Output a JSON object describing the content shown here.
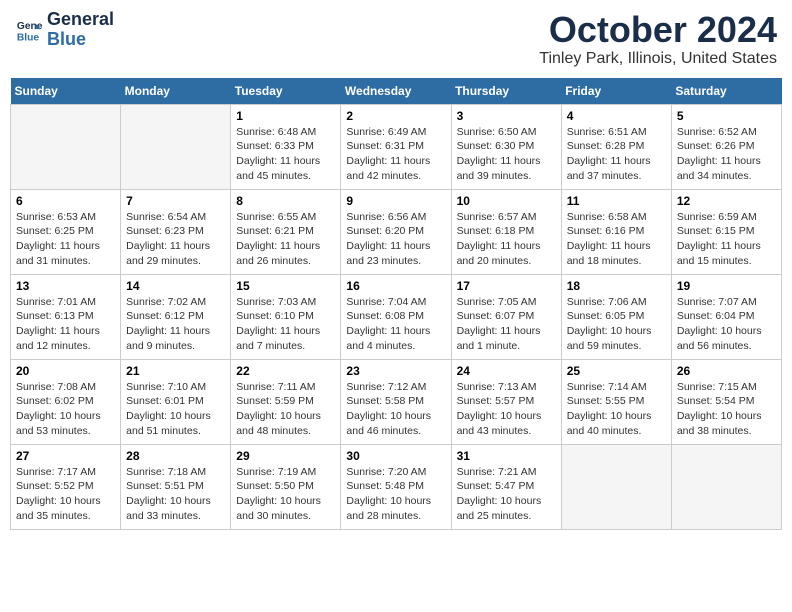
{
  "header": {
    "logo_line1": "General",
    "logo_line2": "Blue",
    "month": "October 2024",
    "location": "Tinley Park, Illinois, United States"
  },
  "weekdays": [
    "Sunday",
    "Monday",
    "Tuesday",
    "Wednesday",
    "Thursday",
    "Friday",
    "Saturday"
  ],
  "weeks": [
    [
      {
        "day": "",
        "sunrise": "",
        "sunset": "",
        "daylight": "",
        "empty": true
      },
      {
        "day": "",
        "sunrise": "",
        "sunset": "",
        "daylight": "",
        "empty": true
      },
      {
        "day": "1",
        "sunrise": "Sunrise: 6:48 AM",
        "sunset": "Sunset: 6:33 PM",
        "daylight": "Daylight: 11 hours and 45 minutes.",
        "empty": false
      },
      {
        "day": "2",
        "sunrise": "Sunrise: 6:49 AM",
        "sunset": "Sunset: 6:31 PM",
        "daylight": "Daylight: 11 hours and 42 minutes.",
        "empty": false
      },
      {
        "day": "3",
        "sunrise": "Sunrise: 6:50 AM",
        "sunset": "Sunset: 6:30 PM",
        "daylight": "Daylight: 11 hours and 39 minutes.",
        "empty": false
      },
      {
        "day": "4",
        "sunrise": "Sunrise: 6:51 AM",
        "sunset": "Sunset: 6:28 PM",
        "daylight": "Daylight: 11 hours and 37 minutes.",
        "empty": false
      },
      {
        "day": "5",
        "sunrise": "Sunrise: 6:52 AM",
        "sunset": "Sunset: 6:26 PM",
        "daylight": "Daylight: 11 hours and 34 minutes.",
        "empty": false
      }
    ],
    [
      {
        "day": "6",
        "sunrise": "Sunrise: 6:53 AM",
        "sunset": "Sunset: 6:25 PM",
        "daylight": "Daylight: 11 hours and 31 minutes.",
        "empty": false
      },
      {
        "day": "7",
        "sunrise": "Sunrise: 6:54 AM",
        "sunset": "Sunset: 6:23 PM",
        "daylight": "Daylight: 11 hours and 29 minutes.",
        "empty": false
      },
      {
        "day": "8",
        "sunrise": "Sunrise: 6:55 AM",
        "sunset": "Sunset: 6:21 PM",
        "daylight": "Daylight: 11 hours and 26 minutes.",
        "empty": false
      },
      {
        "day": "9",
        "sunrise": "Sunrise: 6:56 AM",
        "sunset": "Sunset: 6:20 PM",
        "daylight": "Daylight: 11 hours and 23 minutes.",
        "empty": false
      },
      {
        "day": "10",
        "sunrise": "Sunrise: 6:57 AM",
        "sunset": "Sunset: 6:18 PM",
        "daylight": "Daylight: 11 hours and 20 minutes.",
        "empty": false
      },
      {
        "day": "11",
        "sunrise": "Sunrise: 6:58 AM",
        "sunset": "Sunset: 6:16 PM",
        "daylight": "Daylight: 11 hours and 18 minutes.",
        "empty": false
      },
      {
        "day": "12",
        "sunrise": "Sunrise: 6:59 AM",
        "sunset": "Sunset: 6:15 PM",
        "daylight": "Daylight: 11 hours and 15 minutes.",
        "empty": false
      }
    ],
    [
      {
        "day": "13",
        "sunrise": "Sunrise: 7:01 AM",
        "sunset": "Sunset: 6:13 PM",
        "daylight": "Daylight: 11 hours and 12 minutes.",
        "empty": false
      },
      {
        "day": "14",
        "sunrise": "Sunrise: 7:02 AM",
        "sunset": "Sunset: 6:12 PM",
        "daylight": "Daylight: 11 hours and 9 minutes.",
        "empty": false
      },
      {
        "day": "15",
        "sunrise": "Sunrise: 7:03 AM",
        "sunset": "Sunset: 6:10 PM",
        "daylight": "Daylight: 11 hours and 7 minutes.",
        "empty": false
      },
      {
        "day": "16",
        "sunrise": "Sunrise: 7:04 AM",
        "sunset": "Sunset: 6:08 PM",
        "daylight": "Daylight: 11 hours and 4 minutes.",
        "empty": false
      },
      {
        "day": "17",
        "sunrise": "Sunrise: 7:05 AM",
        "sunset": "Sunset: 6:07 PM",
        "daylight": "Daylight: 11 hours and 1 minute.",
        "empty": false
      },
      {
        "day": "18",
        "sunrise": "Sunrise: 7:06 AM",
        "sunset": "Sunset: 6:05 PM",
        "daylight": "Daylight: 10 hours and 59 minutes.",
        "empty": false
      },
      {
        "day": "19",
        "sunrise": "Sunrise: 7:07 AM",
        "sunset": "Sunset: 6:04 PM",
        "daylight": "Daylight: 10 hours and 56 minutes.",
        "empty": false
      }
    ],
    [
      {
        "day": "20",
        "sunrise": "Sunrise: 7:08 AM",
        "sunset": "Sunset: 6:02 PM",
        "daylight": "Daylight: 10 hours and 53 minutes.",
        "empty": false
      },
      {
        "day": "21",
        "sunrise": "Sunrise: 7:10 AM",
        "sunset": "Sunset: 6:01 PM",
        "daylight": "Daylight: 10 hours and 51 minutes.",
        "empty": false
      },
      {
        "day": "22",
        "sunrise": "Sunrise: 7:11 AM",
        "sunset": "Sunset: 5:59 PM",
        "daylight": "Daylight: 10 hours and 48 minutes.",
        "empty": false
      },
      {
        "day": "23",
        "sunrise": "Sunrise: 7:12 AM",
        "sunset": "Sunset: 5:58 PM",
        "daylight": "Daylight: 10 hours and 46 minutes.",
        "empty": false
      },
      {
        "day": "24",
        "sunrise": "Sunrise: 7:13 AM",
        "sunset": "Sunset: 5:57 PM",
        "daylight": "Daylight: 10 hours and 43 minutes.",
        "empty": false
      },
      {
        "day": "25",
        "sunrise": "Sunrise: 7:14 AM",
        "sunset": "Sunset: 5:55 PM",
        "daylight": "Daylight: 10 hours and 40 minutes.",
        "empty": false
      },
      {
        "day": "26",
        "sunrise": "Sunrise: 7:15 AM",
        "sunset": "Sunset: 5:54 PM",
        "daylight": "Daylight: 10 hours and 38 minutes.",
        "empty": false
      }
    ],
    [
      {
        "day": "27",
        "sunrise": "Sunrise: 7:17 AM",
        "sunset": "Sunset: 5:52 PM",
        "daylight": "Daylight: 10 hours and 35 minutes.",
        "empty": false
      },
      {
        "day": "28",
        "sunrise": "Sunrise: 7:18 AM",
        "sunset": "Sunset: 5:51 PM",
        "daylight": "Daylight: 10 hours and 33 minutes.",
        "empty": false
      },
      {
        "day": "29",
        "sunrise": "Sunrise: 7:19 AM",
        "sunset": "Sunset: 5:50 PM",
        "daylight": "Daylight: 10 hours and 30 minutes.",
        "empty": false
      },
      {
        "day": "30",
        "sunrise": "Sunrise: 7:20 AM",
        "sunset": "Sunset: 5:48 PM",
        "daylight": "Daylight: 10 hours and 28 minutes.",
        "empty": false
      },
      {
        "day": "31",
        "sunrise": "Sunrise: 7:21 AM",
        "sunset": "Sunset: 5:47 PM",
        "daylight": "Daylight: 10 hours and 25 minutes.",
        "empty": false
      },
      {
        "day": "",
        "sunrise": "",
        "sunset": "",
        "daylight": "",
        "empty": true
      },
      {
        "day": "",
        "sunrise": "",
        "sunset": "",
        "daylight": "",
        "empty": true
      }
    ]
  ]
}
